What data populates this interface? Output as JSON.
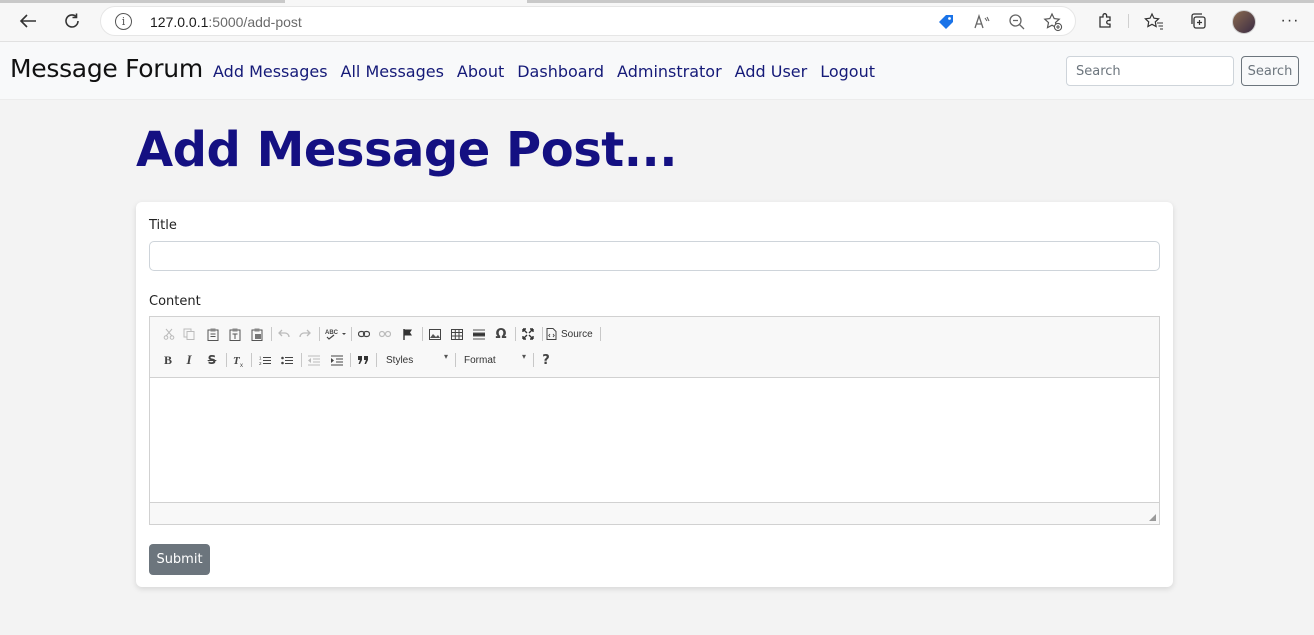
{
  "browser": {
    "url_host": "127.0.0.1",
    "url_path": ":5000/add-post",
    "icons": [
      "back-arrow-icon",
      "refresh-icon",
      "site-info-icon",
      "tag-icon",
      "read-aloud-icon",
      "zoom-out-icon",
      "add-favorite-icon",
      "extensions-icon",
      "favorites-icon",
      "collections-icon",
      "profile-avatar",
      "more-icon"
    ],
    "tag_color": "#1a73e8"
  },
  "navbar": {
    "brand": "Message Forum",
    "links": [
      "Add Messages",
      "All Messages",
      "About",
      "Dashboard",
      "Adminstrator",
      "Add User",
      "Logout"
    ],
    "search_placeholder": "Search",
    "search_button": "Search",
    "link_color": "#151a78"
  },
  "main": {
    "heading": "Add Message Post...",
    "heading_color": "#141082"
  },
  "form": {
    "title_label": "Title",
    "title_value": "",
    "content_label": "Content",
    "submit_label": "Submit"
  },
  "editor": {
    "row1": [
      "cut-icon",
      "copy-icon",
      "paste-icon",
      "paste-text-icon",
      "paste-word-icon",
      "undo-icon",
      "redo-icon",
      "spellcheck-icon",
      "link-icon",
      "unlink-icon",
      "anchor-icon",
      "image-icon",
      "table-icon",
      "horizontal-rule-icon",
      "special-char-icon",
      "maximize-icon",
      "source-icon"
    ],
    "source_label": "Source",
    "row2": [
      "bold-icon",
      "italic-icon",
      "strike-icon",
      "remove-format-icon",
      "numbered-list-icon",
      "bulleted-list-icon",
      "outdent-icon",
      "indent-icon",
      "blockquote-icon",
      "help-icon"
    ],
    "styles_label": "Styles",
    "format_label": "Format",
    "bold_glyph": "B",
    "italic_glyph": "I",
    "strike_glyph": "S",
    "help_glyph": "?",
    "omega_glyph": "Ω"
  }
}
